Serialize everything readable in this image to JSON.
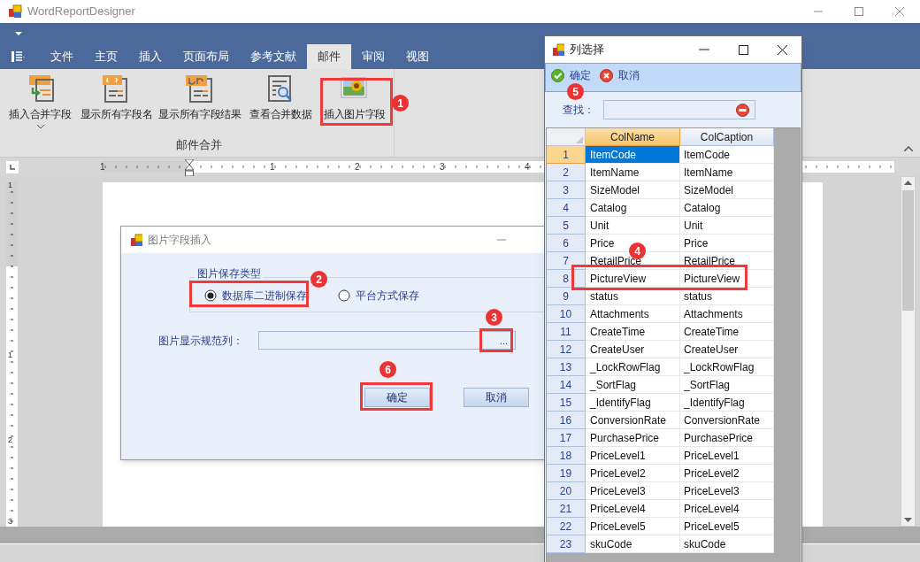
{
  "window": {
    "title": "WordReportDesigner"
  },
  "ribbon": {
    "tabs": [
      {
        "label": "文件",
        "selected": false
      },
      {
        "label": "主页",
        "selected": false
      },
      {
        "label": "插入",
        "selected": false
      },
      {
        "label": "页面布局",
        "selected": false
      },
      {
        "label": "参考文献",
        "selected": false
      },
      {
        "label": "邮件",
        "selected": true
      },
      {
        "label": "审阅",
        "selected": false
      },
      {
        "label": "视图",
        "selected": false
      }
    ],
    "buttons": [
      {
        "label": "插入合并字段",
        "kind": "insert-field",
        "dropdown": true
      },
      {
        "label": "显示所有字段名",
        "kind": "field-names",
        "dropdown": false
      },
      {
        "label": "显示所有字段结果",
        "kind": "field-results",
        "dropdown": false
      },
      {
        "label": "查看合并数据",
        "kind": "view-data",
        "dropdown": false
      },
      {
        "label": "插入图片字段",
        "kind": "picture",
        "dropdown": false
      }
    ],
    "group_label": "邮件合并"
  },
  "ruler": {
    "horizontal": [
      "1",
      "1",
      "2",
      "3",
      "4"
    ],
    "vertical": [
      "1",
      "1",
      "2",
      "3"
    ]
  },
  "picture_dialog": {
    "title": "图片字段插入",
    "group_title": "图片保存类型",
    "radios": [
      {
        "label": "数据库二进制保存",
        "selected": true
      },
      {
        "label": "平台方式保存",
        "selected": false
      }
    ],
    "field_label": "图片显示规范列：",
    "browse_button": "...",
    "buttons": [
      "确定",
      "取消"
    ]
  },
  "column_dialog": {
    "title": "列选择",
    "toolbar": [
      {
        "label": "确定",
        "kind": "ok"
      },
      {
        "label": "取消",
        "kind": "cancel"
      }
    ],
    "search_label": "查找：",
    "columns": [
      {
        "label": "ColName",
        "selected": true
      },
      {
        "label": "ColCaption",
        "selected": false
      }
    ],
    "rows": [
      {
        "number": "1",
        "col_name": "ItemCode",
        "col_caption": "ItemCode",
        "selected": true
      },
      {
        "number": "2",
        "col_name": "ItemName",
        "col_caption": "ItemName",
        "selected": false
      },
      {
        "number": "3",
        "col_name": "SizeModel",
        "col_caption": "SizeModel",
        "selected": false
      },
      {
        "number": "4",
        "col_name": "Catalog",
        "col_caption": "Catalog",
        "selected": false
      },
      {
        "number": "5",
        "col_name": "Unit",
        "col_caption": "Unit",
        "selected": false
      },
      {
        "number": "6",
        "col_name": "Price",
        "col_caption": "Price",
        "selected": false
      },
      {
        "number": "7",
        "col_name": "RetailPrice",
        "col_caption": "RetailPrice",
        "selected": false
      },
      {
        "number": "8",
        "col_name": "PictureView",
        "col_caption": "PictureView",
        "selected": false
      },
      {
        "number": "9",
        "col_name": "status",
        "col_caption": "status",
        "selected": false
      },
      {
        "number": "10",
        "col_name": "Attachments",
        "col_caption": "Attachments",
        "selected": false
      },
      {
        "number": "11",
        "col_name": "CreateTime",
        "col_caption": "CreateTime",
        "selected": false
      },
      {
        "number": "12",
        "col_name": "CreateUser",
        "col_caption": "CreateUser",
        "selected": false
      },
      {
        "number": "13",
        "col_name": "_LockRowFlag",
        "col_caption": "_LockRowFlag",
        "selected": false
      },
      {
        "number": "14",
        "col_name": "_SortFlag",
        "col_caption": "_SortFlag",
        "selected": false
      },
      {
        "number": "15",
        "col_name": "_IdentifyFlag",
        "col_caption": "_IdentifyFlag",
        "selected": false
      },
      {
        "number": "16",
        "col_name": "ConversionRate",
        "col_caption": "ConversionRate",
        "selected": false
      },
      {
        "number": "17",
        "col_name": "PurchasePrice",
        "col_caption": "PurchasePrice",
        "selected": false
      },
      {
        "number": "18",
        "col_name": "PriceLevel1",
        "col_caption": "PriceLevel1",
        "selected": false
      },
      {
        "number": "19",
        "col_name": "PriceLevel2",
        "col_caption": "PriceLevel2",
        "selected": false
      },
      {
        "number": "20",
        "col_name": "PriceLevel3",
        "col_caption": "PriceLevel3",
        "selected": false
      },
      {
        "number": "21",
        "col_name": "PriceLevel4",
        "col_caption": "PriceLevel4",
        "selected": false
      },
      {
        "number": "22",
        "col_name": "PriceLevel5",
        "col_caption": "PriceLevel5",
        "selected": false
      },
      {
        "number": "23",
        "col_name": "skuCode",
        "col_caption": "skuCode",
        "selected": false
      }
    ]
  },
  "annotations": [
    "1",
    "2",
    "3",
    "4",
    "5",
    "6"
  ]
}
